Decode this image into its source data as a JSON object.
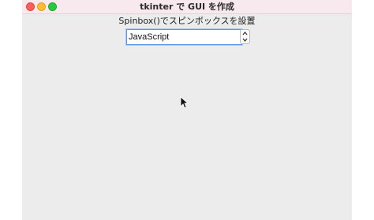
{
  "window": {
    "title": "tkinter で GUI を作成"
  },
  "label": {
    "text": "Spinbox()でスピンボックスを設置"
  },
  "spinbox": {
    "value": "JavaScript"
  },
  "icons": {
    "close": "close-traffic-light",
    "minimize": "minimize-traffic-light",
    "zoom": "zoom-traffic-light",
    "spin_up": "chevron-up-icon",
    "spin_down": "chevron-down-icon",
    "cursor": "mouse-pointer-icon"
  }
}
